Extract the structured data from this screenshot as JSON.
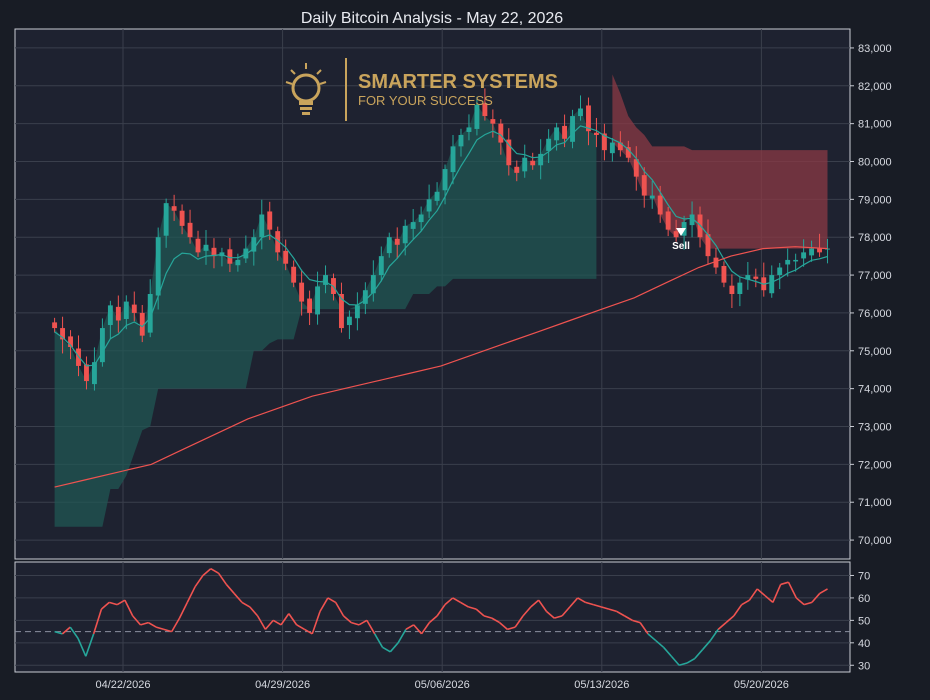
{
  "chart_data": [
    {
      "type": "candlestick",
      "title": "Daily Bitcoin Analysis - May 22, 2026",
      "ylim": [
        69500,
        83500
      ],
      "yticks": [
        "70,000",
        "71,000",
        "72,000",
        "73,000",
        "74,000",
        "75,000",
        "76,000",
        "77,000",
        "78,000",
        "79,000",
        "80,000",
        "81,000",
        "82,000",
        "83,000"
      ],
      "x_dates": [
        "04/22/2026",
        "04/29/2026",
        "05/06/2026",
        "05/13/2026",
        "05/20/2026"
      ],
      "x_start_day": -5.0,
      "x_end_day": 34.5,
      "close_values": [
        75600,
        75300,
        75100,
        74600,
        74200,
        74700,
        75600,
        76200,
        75800,
        76300,
        76000,
        75400,
        76500,
        78000,
        78900,
        78700,
        78300,
        78000,
        77600,
        77800,
        77500,
        77600,
        77300,
        77400,
        77700,
        78000,
        78600,
        78200,
        77600,
        77300,
        76800,
        76300,
        76000,
        76700,
        77000,
        76500,
        75600,
        75900,
        76200,
        76600,
        77000,
        77500,
        78000,
        77800,
        78300,
        78400,
        78600,
        79000,
        79200,
        79800,
        80400,
        80700,
        80900,
        81500,
        81200,
        81000,
        80500,
        79900,
        79700,
        80100,
        79900,
        80200,
        80600,
        80900,
        80600,
        81200,
        81400,
        80800,
        80700,
        80300,
        80500,
        80300,
        80100,
        79600,
        79100,
        79100,
        78600,
        78200,
        78000,
        78400,
        78600,
        78000,
        77500,
        77200,
        76800,
        76500,
        76800,
        77000,
        76900,
        76600,
        77000,
        77200,
        77400,
        77400,
        77600,
        77700,
        77600,
        77700
      ],
      "series": [
        {
          "values": [
            75500,
            75350,
            75150,
            74850,
            74600,
            74620,
            74960,
            75320,
            75440,
            75670,
            75760,
            75640,
            75870,
            76440,
            77050,
            77430,
            77580,
            77560,
            77420,
            77500,
            77520,
            77540,
            77460,
            77460,
            77550,
            77700,
            77990,
            78060,
            77910,
            77730,
            77450,
            77120,
            76880,
            76830,
            76820,
            76700,
            76370,
            76220,
            76210,
            76340,
            76550,
            76850,
            77230,
            77440,
            77710,
            77940,
            78160,
            78450,
            78700,
            79070,
            79500,
            79880,
            80210,
            80570,
            80710,
            80800,
            80700,
            80440,
            80210,
            80180,
            80100,
            80120,
            80260,
            80440,
            80500,
            80740,
            80940,
            80880,
            80820,
            80680,
            80590,
            80490,
            80320,
            80080,
            79740,
            79520,
            79190,
            78850,
            78550,
            78480,
            78500,
            78320,
            78060,
            77780,
            77420,
            77100,
            76950,
            76890,
            76830,
            76760,
            76810,
            76910,
            77050,
            77130,
            77270,
            77390,
            77430,
            77490
          ]
        },
        {
          "values": [
            71400,
            71600,
            71800,
            72000,
            72400,
            72800,
            73200,
            73500,
            73800,
            74000,
            74200,
            74400,
            74600,
            74900,
            75200,
            75500,
            75800,
            76100,
            76400,
            76800,
            77200,
            77500,
            77700,
            77750,
            77700
          ]
        },
        {
          "values": [
            45,
            44,
            47,
            42,
            34,
            44,
            55,
            58,
            57,
            59,
            52,
            48,
            49,
            47,
            46,
            45,
            51,
            58,
            65,
            70,
            73,
            71,
            66,
            62,
            58,
            56,
            52,
            46,
            50,
            48,
            53,
            48,
            46,
            44,
            54,
            60,
            58,
            52,
            49,
            48,
            50,
            44,
            38,
            36,
            40,
            46,
            48,
            44,
            49,
            52,
            57,
            60,
            58,
            56,
            55,
            52,
            51,
            49,
            46,
            47,
            52,
            56,
            59,
            54,
            51,
            52,
            56,
            60,
            58,
            57,
            56,
            55,
            54,
            52,
            50,
            49,
            44,
            41,
            38,
            34,
            30,
            31,
            33,
            37,
            41,
            46,
            49,
            52,
            57,
            59,
            64,
            61,
            58,
            66,
            67,
            60,
            57,
            58,
            62,
            64
          ]
        }
      ]
    }
  ],
  "rsi_panel": {
    "yticks": [
      "30",
      "40",
      "50",
      "60",
      "70"
    ],
    "ylim": [
      27,
      76
    ],
    "midline": 45
  },
  "signal": {
    "label": "Sell"
  },
  "logo": {
    "line1": "SMARTER SYSTEMS",
    "line2": "FOR YOUR SUCCESS",
    "color": "#c9a45c"
  },
  "colors": {
    "up": "#26a69a",
    "down": "#ef5350",
    "fast_ma": "#26a69a",
    "slow_ma": "#ef5350",
    "rsi_up": "#ef5350",
    "rsi_down": "#26a69a",
    "upper_cloud": "#8b3a44",
    "lower_cloud": "#1f5a55"
  }
}
